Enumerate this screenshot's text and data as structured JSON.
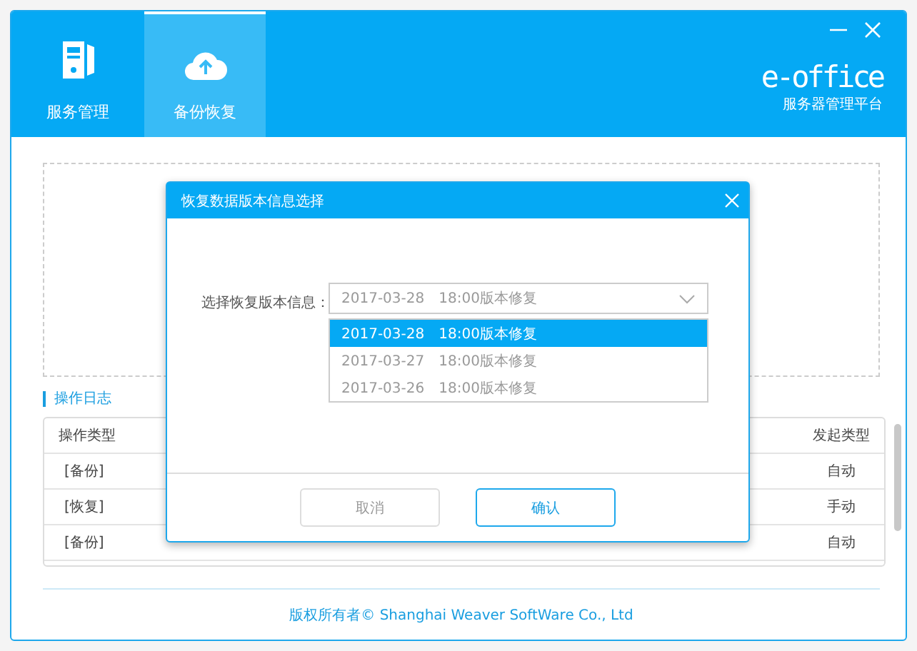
{
  "tabs": [
    {
      "label": "服务管理",
      "kind": "server",
      "selected": false
    },
    {
      "label": "备份恢复",
      "kind": "cloud",
      "selected": true
    }
  ],
  "brand": {
    "name": "e-office",
    "subtitle": "服务器管理平台"
  },
  "log": {
    "title": "操作日志",
    "columns": [
      "操作类型",
      "发起类型"
    ],
    "rows": [
      {
        "type": "[备份]",
        "initiator": "自动"
      },
      {
        "type": "[恢复]",
        "initiator": "手动"
      },
      {
        "type": "[备份]",
        "initiator": "自动"
      }
    ]
  },
  "footer": "版权所有者© Shanghai Weaver SoftWare Co., Ltd",
  "dialog": {
    "title": "恢复数据版本信息选择",
    "label": "选择恢复版本信息：",
    "value": "2017-03-28　18:00版本修复",
    "options": [
      {
        "label": "2017-03-28　18:00版本修复",
        "selected": true
      },
      {
        "label": "2017-03-27　18:00版本修复",
        "selected": false
      },
      {
        "label": "2017-03-26　18:00版本修复",
        "selected": false
      }
    ],
    "buttons": [
      {
        "label": "取消",
        "kind": "secondary"
      },
      {
        "label": "确认",
        "kind": "primary"
      }
    ]
  }
}
